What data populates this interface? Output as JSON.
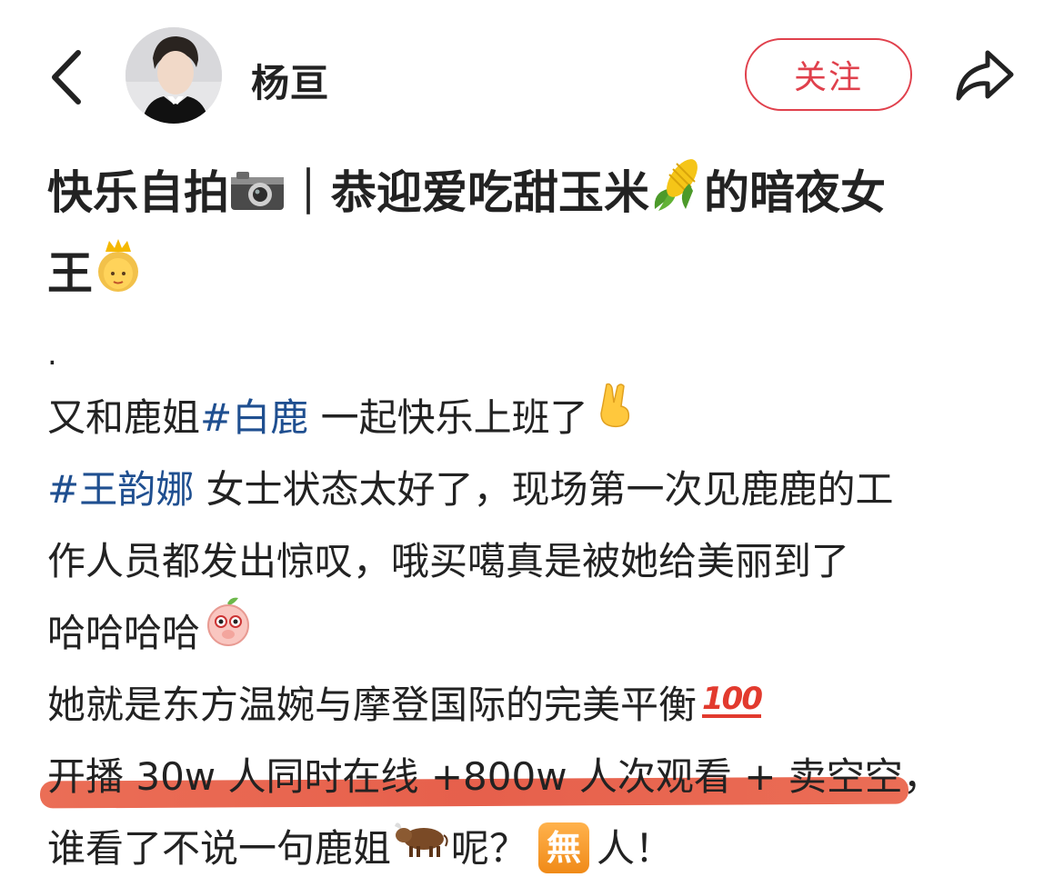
{
  "header": {
    "author_name": "杨亘",
    "follow_label": "关注",
    "accent_color": "#e0404c"
  },
  "post": {
    "title_part1": "快乐自拍",
    "title_part2": "｜恭迎爱吃甜玉米",
    "title_part3": "的暗夜女",
    "title_part4": "王",
    "dot": ".",
    "line1_pre": "又和鹿姐",
    "line1_tag": "#白鹿",
    "line1_post": " 一起快乐上班了",
    "line2_tag": "#王韵娜",
    "line2_post": " 女士状态太好了，现场第一次见鹿鹿的工",
    "line3": "作人员都发出惊叹，哦买噶真是被她给美丽到了",
    "line4": "哈哈哈哈",
    "line5": "她就是东方温婉与摩登国际的完美平衡",
    "line6_highlight": "开播 30w 人同时在线 +800w 人次观看 + 卖空空",
    "line6_post": "，",
    "line7_pre": "谁看了不说一句鹿姐",
    "line7_mid": "呢？",
    "badge_char": "無",
    "line7_post": "人！",
    "hundred_label": "100",
    "hashtag_color": "#1f4f90",
    "highlight_color": "#e34a33"
  }
}
